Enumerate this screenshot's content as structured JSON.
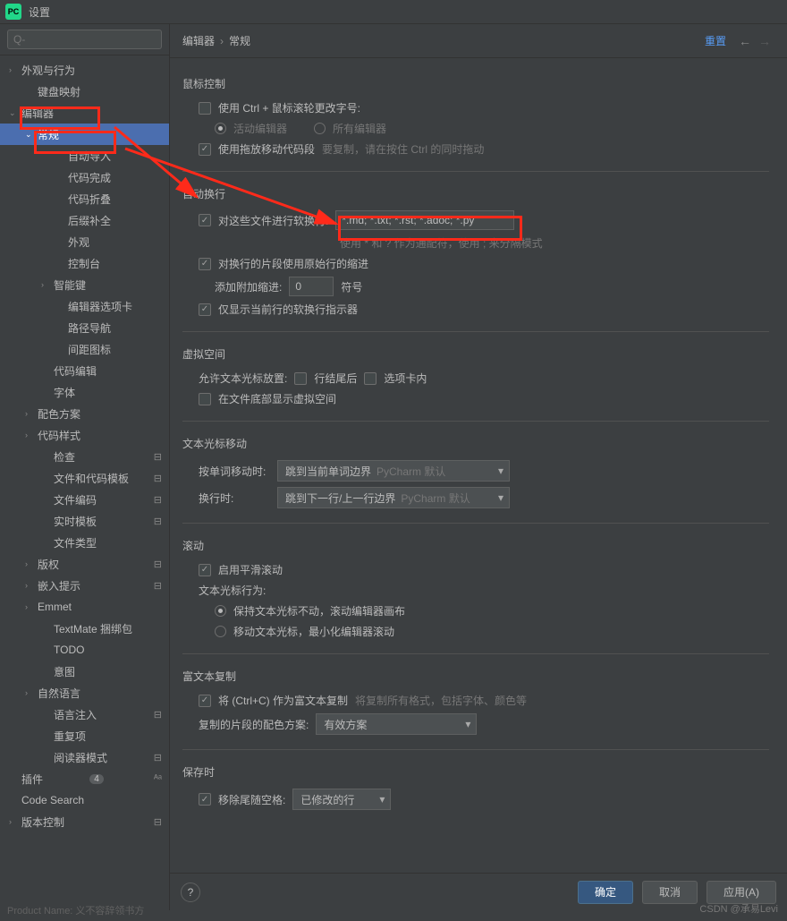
{
  "title": "设置",
  "logo": "PC",
  "search_placeholder": "Q-",
  "breadcrumb": {
    "p1": "编辑器",
    "p2": "常规",
    "reset": "重置"
  },
  "sidebar": {
    "items": [
      {
        "l": "外观与行为",
        "chev": ">",
        "cls": ""
      },
      {
        "l": "键盘映射",
        "chev": "",
        "cls": "ind1"
      },
      {
        "l": "编辑器",
        "chev": "v",
        "cls": ""
      },
      {
        "l": "常规",
        "chev": "v",
        "cls": "ind1 selected"
      },
      {
        "l": "自动导入",
        "chev": "",
        "cls": "ind3"
      },
      {
        "l": "代码完成",
        "chev": "",
        "cls": "ind3"
      },
      {
        "l": "代码折叠",
        "chev": "",
        "cls": "ind3"
      },
      {
        "l": "后缀补全",
        "chev": "",
        "cls": "ind3"
      },
      {
        "l": "外观",
        "chev": "",
        "cls": "ind3"
      },
      {
        "l": "控制台",
        "chev": "",
        "cls": "ind3"
      },
      {
        "l": "智能键",
        "chev": ">",
        "cls": "ind2"
      },
      {
        "l": "编辑器选项卡",
        "chev": "",
        "cls": "ind3"
      },
      {
        "l": "路径导航",
        "chev": "",
        "cls": "ind3"
      },
      {
        "l": "间距图标",
        "chev": "",
        "cls": "ind3"
      },
      {
        "l": "代码编辑",
        "chev": "",
        "cls": "ind2"
      },
      {
        "l": "字体",
        "chev": "",
        "cls": "ind2"
      },
      {
        "l": "配色方案",
        "chev": ">",
        "cls": "ind1"
      },
      {
        "l": "代码样式",
        "chev": ">",
        "cls": "ind1"
      },
      {
        "l": "检查",
        "chev": "",
        "cls": "ind2",
        "ico": "⊟"
      },
      {
        "l": "文件和代码模板",
        "chev": "",
        "cls": "ind2",
        "ico": "⊟"
      },
      {
        "l": "文件编码",
        "chev": "",
        "cls": "ind2",
        "ico": "⊟"
      },
      {
        "l": "实时模板",
        "chev": "",
        "cls": "ind2",
        "ico": "⊟"
      },
      {
        "l": "文件类型",
        "chev": "",
        "cls": "ind2"
      },
      {
        "l": "版权",
        "chev": ">",
        "cls": "ind1",
        "ico": "⊟"
      },
      {
        "l": "嵌入提示",
        "chev": ">",
        "cls": "ind1",
        "ico": "⊟"
      },
      {
        "l": "Emmet",
        "chev": ">",
        "cls": "ind1"
      },
      {
        "l": "TextMate 捆绑包",
        "chev": "",
        "cls": "ind2"
      },
      {
        "l": "TODO",
        "chev": "",
        "cls": "ind2"
      },
      {
        "l": "意图",
        "chev": "",
        "cls": "ind2"
      },
      {
        "l": "自然语言",
        "chev": ">",
        "cls": "ind1"
      },
      {
        "l": "语言注入",
        "chev": "",
        "cls": "ind2",
        "ico": "⊟"
      },
      {
        "l": "重复项",
        "chev": "",
        "cls": "ind2"
      },
      {
        "l": "阅读器模式",
        "chev": "",
        "cls": "ind2",
        "ico": "⊟"
      },
      {
        "l": "插件",
        "chev": "",
        "cls": "",
        "badge": "4",
        "ico": "ᴬᵃ"
      },
      {
        "l": "Code Search",
        "chev": "",
        "cls": ""
      },
      {
        "l": "版本控制",
        "chev": ">",
        "cls": "",
        "ico": "⊟"
      }
    ]
  },
  "section_mouse": {
    "title": "鼠标控制",
    "ctrl_wheel": "使用 Ctrl + 鼠标滚轮更改字号:",
    "active": "活动编辑器",
    "all": "所有编辑器",
    "drag_move": "使用拖放移动代码段",
    "drag_hint": "要复制，请在按住 Ctrl 的同时拖动"
  },
  "section_wrap": {
    "title": "自动换行",
    "soft_wrap_label": "对这些文件进行软换行:",
    "soft_wrap_value": "*.md; *.txt; *.rst; *.adoc; *.py",
    "hint": "使用 * 和 ? 作为通配符，使用 ; 来分隔模式",
    "indent": "对换行的片段使用原始行的缩进",
    "add_indent": "添加附加缩进:",
    "add_indent_val": "0",
    "unit": "符号",
    "only_current": "仅显示当前行的软换行指示器"
  },
  "section_virtual": {
    "title": "虚拟空间",
    "allow": "允许文本光标放置:",
    "end": "行结尾后",
    "tab": "选项卡内",
    "bottom": "在文件底部显示虚拟空间"
  },
  "section_caret": {
    "title": "文本光标移动",
    "by_word": "按单词移动时:",
    "dd1": "跳到当前单词边界",
    "def": "PyCharm 默认",
    "line": "换行时:",
    "dd2": "跳到下一行/上一行边界"
  },
  "section_scroll": {
    "title": "滚动",
    "smooth": "启用平滑滚动",
    "behavior": "文本光标行为:",
    "r1": "保持文本光标不动，滚动编辑器画布",
    "r2": "移动文本光标，最小化编辑器滚动"
  },
  "section_rich": {
    "title": "富文本复制",
    "ctrlc": "将  (Ctrl+C) 作为富文本复制",
    "hint": "将复制所有格式，包括字体、颜色等",
    "scheme": "复制的片段的配色方案:",
    "scheme_val": "有效方案"
  },
  "section_save": {
    "title": "保存时",
    "trim": "移除尾随空格:",
    "trim_val": "已修改的行"
  },
  "footer": {
    "ok": "确定",
    "cancel": "取消",
    "apply": "应用(A)"
  },
  "watermark": "CSDN @承易Levi",
  "bottom_text": "Product Name: 义不容辞领书方"
}
